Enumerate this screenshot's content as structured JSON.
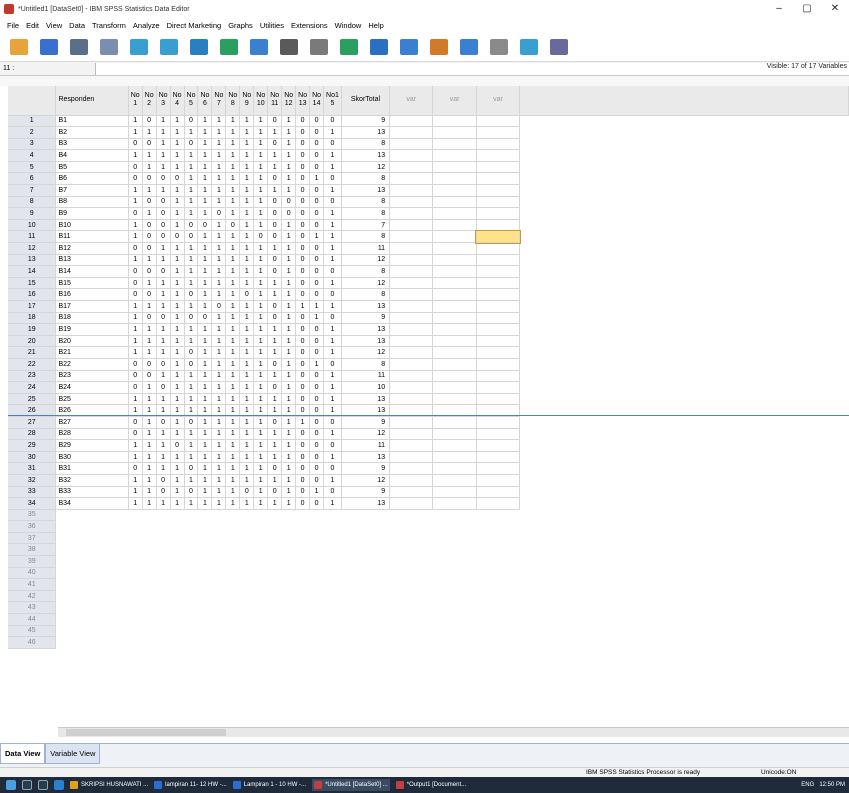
{
  "window": {
    "title": "*Untitled1 [DataSet0] - IBM SPSS Statistics Data Editor",
    "minimize": "–",
    "maximize": "▢",
    "close": "✕"
  },
  "menu": [
    "File",
    "Edit",
    "View",
    "Data",
    "Transform",
    "Analyze",
    "Direct Marketing",
    "Graphs",
    "Utilities",
    "Extensions",
    "Window",
    "Help"
  ],
  "toolbar": [
    "open-icon",
    "save-icon",
    "print-icon",
    "dialog-recall-icon",
    "undo-icon",
    "redo-icon",
    "goto-case-icon",
    "goto-variable-icon",
    "variables-icon",
    "run-icon",
    "find-icon",
    "insert-cases-icon",
    "insert-variable-icon",
    "split-file-icon",
    "weight-cases-icon",
    "select-cases-icon",
    "value-labels-icon",
    "use-sets-icon",
    "spell-check-icon"
  ],
  "cellbar": {
    "ref": "11 :",
    "visible": "Visible: 17 of 17 Variables"
  },
  "columns": {
    "responden": "Responden",
    "items": [
      [
        "No",
        "1"
      ],
      [
        "No",
        "2"
      ],
      [
        "No",
        "3"
      ],
      [
        "No",
        "4"
      ],
      [
        "No",
        "5"
      ],
      [
        "No",
        "6"
      ],
      [
        "No",
        "7"
      ],
      [
        "No",
        "8"
      ],
      [
        "No",
        "9"
      ],
      [
        "No",
        "10"
      ],
      [
        "No",
        "11"
      ],
      [
        "No",
        "12"
      ],
      [
        "No",
        "13"
      ],
      [
        "No",
        "14"
      ],
      [
        "No1",
        "5"
      ]
    ],
    "total": "SkorTotal",
    "var": [
      "var",
      "var",
      "var"
    ]
  },
  "rows": [
    {
      "n": "1",
      "r": "B1",
      "v": "1 0 1 1 0 1 1 1 1 1 0 1 0 0 0",
      "t": "9"
    },
    {
      "n": "2",
      "r": "B2",
      "v": "1 1 1 1 1 1 1 1 1 1 1 1 0 0 1",
      "t": "13"
    },
    {
      "n": "3",
      "r": "B3",
      "v": "0 0 1 1 0 1 1 1 1 1 0 1 0 0 0",
      "t": "8"
    },
    {
      "n": "4",
      "r": "B4",
      "v": "1 1 1 1 1 1 1 1 1 1 1 1 0 0 1",
      "t": "13"
    },
    {
      "n": "5",
      "r": "B5",
      "v": "0 1 1 1 1 1 1 1 1 1 1 1 0 0 1",
      "t": "12"
    },
    {
      "n": "6",
      "r": "B6",
      "v": "0 0 0 0 1 1 1 1 1 1 0 1 0 1 0",
      "t": "8"
    },
    {
      "n": "7",
      "r": "B7",
      "v": "1 1 1 1 1 1 1 1 1 1 1 1 0 0 1",
      "t": "13"
    },
    {
      "n": "8",
      "r": "B8",
      "v": "1 0 0 1 1 1 1 1 1 1 0 0 0 0 0",
      "t": "8"
    },
    {
      "n": "9",
      "r": "B9",
      "v": "0 1 0 1 1 1 0 1 1 1 0 0 0 0 1",
      "t": "8"
    },
    {
      "n": "10",
      "r": "B10",
      "v": "1 0 0 1 0 0 1 0 1 1 0 1 0 0 1",
      "t": "7"
    },
    {
      "n": "11",
      "r": "B11",
      "v": "1 0 0 0 0 1 1 1 1 0 0 1 0 1 1",
      "t": "8"
    },
    {
      "n": "12",
      "r": "B12",
      "v": "0 0 1 1 1 1 1 1 1 1 1 1 0 0 1",
      "t": "11"
    },
    {
      "n": "13",
      "r": "B13",
      "v": "1 1 1 1 1 1 1 1 1 1 0 1 0 0 1",
      "t": "12"
    },
    {
      "n": "14",
      "r": "B14",
      "v": "0 0 0 1 1 1 1 1 1 1 0 1 0 0 0",
      "t": "8"
    },
    {
      "n": "15",
      "r": "B15",
      "v": "0 1 1 1 1 1 1 1 1 1 1 1 0 0 1",
      "t": "12"
    },
    {
      "n": "16",
      "r": "B16",
      "v": "0 0 1 1 0 1 1 1 0 1 1 1 0 0 0",
      "t": "8"
    },
    {
      "n": "17",
      "r": "B17",
      "v": "1 1 1 1 1 1 0 1 1 1 0 1 1 1 1",
      "t": "13"
    },
    {
      "n": "18",
      "r": "B18",
      "v": "1 0 0 1 0 0 1 1 1 1 0 1 0 1 0",
      "t": "9"
    },
    {
      "n": "19",
      "r": "B19",
      "v": "1 1 1 1 1 1 1 1 1 1 1 1 0 0 1",
      "t": "13"
    },
    {
      "n": "20",
      "r": "B20",
      "v": "1 1 1 1 1 1 1 1 1 1 1 1 0 0 1",
      "t": "13"
    },
    {
      "n": "21",
      "r": "B21",
      "v": "1 1 1 1 0 1 1 1 1 1 1 1 0 0 1",
      "t": "12"
    },
    {
      "n": "22",
      "r": "B22",
      "v": "0 0 0 1 0 1 1 1 1 1 0 1 0 1 0",
      "t": "8"
    },
    {
      "n": "23",
      "r": "B23",
      "v": "0 0 1 1 1 1 1 1 1 1 1 1 0 0 1",
      "t": "11"
    },
    {
      "n": "24",
      "r": "B24",
      "v": "0 1 0 1 1 1 1 1 1 1 0 1 0 0 1",
      "t": "10"
    },
    {
      "n": "25",
      "r": "B25",
      "v": "1 1 1 1 1 1 1 1 1 1 1 1 0 0 1",
      "t": "13"
    },
    {
      "n": "26",
      "r": "B26",
      "v": "1 1 1 1 1 1 1 1 1 1 1 1 0 0 1",
      "t": "13"
    },
    {
      "n": "27",
      "r": "B27",
      "v": "0 1 0 1 0 1 1 1 1 1 0 1 1 0 0",
      "t": "9"
    },
    {
      "n": "28",
      "r": "B28",
      "v": "0 1 1 1 1 1 1 1 1 1 1 1 0 0 1",
      "t": "12"
    },
    {
      "n": "29",
      "r": "B29",
      "v": "1 1 1 0 1 1 1 1 1 1 1 1 0 0 0",
      "t": "11"
    },
    {
      "n": "30",
      "r": "B30",
      "v": "1 1 1 1 1 1 1 1 1 1 1 1 0 0 1",
      "t": "13"
    },
    {
      "n": "31",
      "r": "B31",
      "v": "0 1 1 1 0 1 1 1 1 1 0 1 0 0 0",
      "t": "9"
    },
    {
      "n": "32",
      "r": "B32",
      "v": "1 1 0 1 1 1 1 1 1 1 1 1 0 0 1",
      "t": "12"
    },
    {
      "n": "33",
      "r": "B33",
      "v": "1 1 0 1 0 1 1 1 0 1 0 1 0 1 0",
      "t": "9"
    },
    {
      "n": "34",
      "r": "B34",
      "v": "1 1 1 1 1 1 1 1 1 1 1 1 0 0 1",
      "t": "13"
    }
  ],
  "empty_rows": [
    "35",
    "36",
    "37",
    "38",
    "39",
    "40",
    "41",
    "42",
    "43",
    "44",
    "45",
    "46"
  ],
  "tabs": {
    "data": "Data View",
    "variable": "Variable View"
  },
  "status": {
    "processor": "IBM SPSS Statistics Processor is ready",
    "unicode": "Unicode:ON"
  },
  "taskbar": {
    "apps": [
      "SKRIPSI HUSNAWATI ...",
      "lampiran 11- 12 HW -...",
      "Lampiran 1 - 10 HW -...",
      "*Untitled1 [DataSet0] ...",
      "*Output1 [Document..."
    ],
    "lang": "ENG",
    "time": "12:50 PM"
  },
  "colors": {
    "selected_cell": "#ffe28a",
    "row_header": "#e2e6ec",
    "split_line": "#4a7fd4",
    "taskbar": "#1f2b3a"
  }
}
